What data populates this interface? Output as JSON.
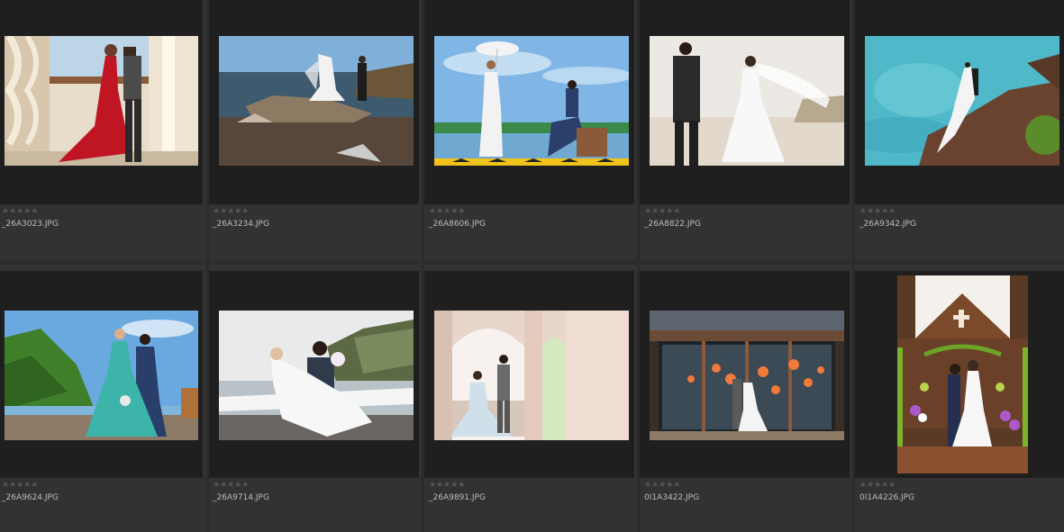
{
  "rating_glyphs": "★★★★★",
  "photos": [
    {
      "filename": "_26A3023.JPG",
      "icon": "bride-red-dress-columns-photo"
    },
    {
      "filename": "_26A3234.JPG",
      "icon": "couple-rocky-shore-photo"
    },
    {
      "filename": "_26A8606.JPG",
      "icon": "bride-parasol-pier-photo"
    },
    {
      "filename": "_26A8822.JPG",
      "icon": "couple-beach-veil-photo"
    },
    {
      "filename": "_26A9342.JPG",
      "icon": "couple-cliff-turquoise-sea-photo"
    },
    {
      "filename": "_26A9624.JPG",
      "icon": "bride-teal-gown-coast-photo"
    },
    {
      "filename": "_26A9714.JPG",
      "icon": "groom-lifting-bride-photo"
    },
    {
      "filename": "_26A9891.JPG",
      "icon": "couple-arch-pavilion-photo"
    },
    {
      "filename": "0I1A3422.JPG",
      "icon": "couple-glass-doors-lanterns-photo"
    },
    {
      "filename": "0I1A4226.JPG",
      "icon": "couple-chapel-kiss-photo"
    }
  ]
}
